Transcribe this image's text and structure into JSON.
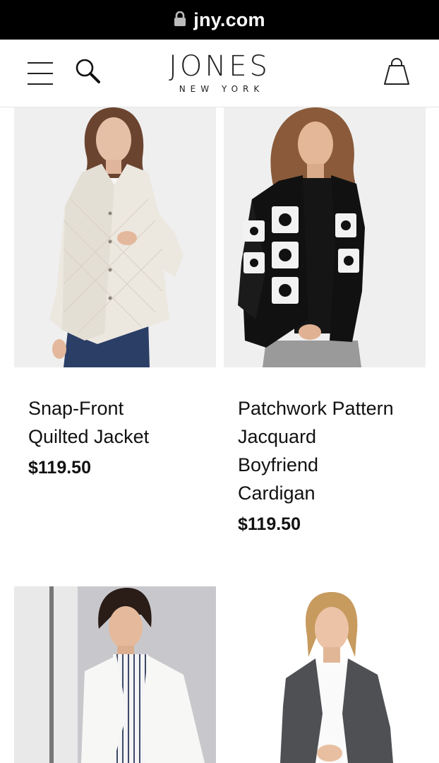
{
  "browser": {
    "domain": "jny.com",
    "lock_icon": "lock-icon"
  },
  "header": {
    "menu_icon": "hamburger-menu-icon",
    "search_icon": "search-icon",
    "logo_brand": "JONES",
    "logo_sub": "NEW YORK",
    "bag_icon": "shopping-bag-icon"
  },
  "products": [
    {
      "name_line1": "Snap-Front",
      "name_line2": "Quilted Jacket",
      "price": "$119.50",
      "image_icon": "quilted-jacket-photo"
    },
    {
      "name_line1": "Patchwork Pattern",
      "name_line2": "Jacquard",
      "name_line3": "Boyfriend",
      "name_line4": "Cardigan",
      "price": "$119.50",
      "image_icon": "patchwork-cardigan-photo"
    },
    {
      "image_icon": "white-blazer-photo"
    },
    {
      "image_icon": "grey-blazer-photo"
    }
  ],
  "colors": {
    "url_bar": "#000000",
    "background": "#ffffff",
    "photo_bg": "#eeeeee",
    "text": "#111111"
  }
}
